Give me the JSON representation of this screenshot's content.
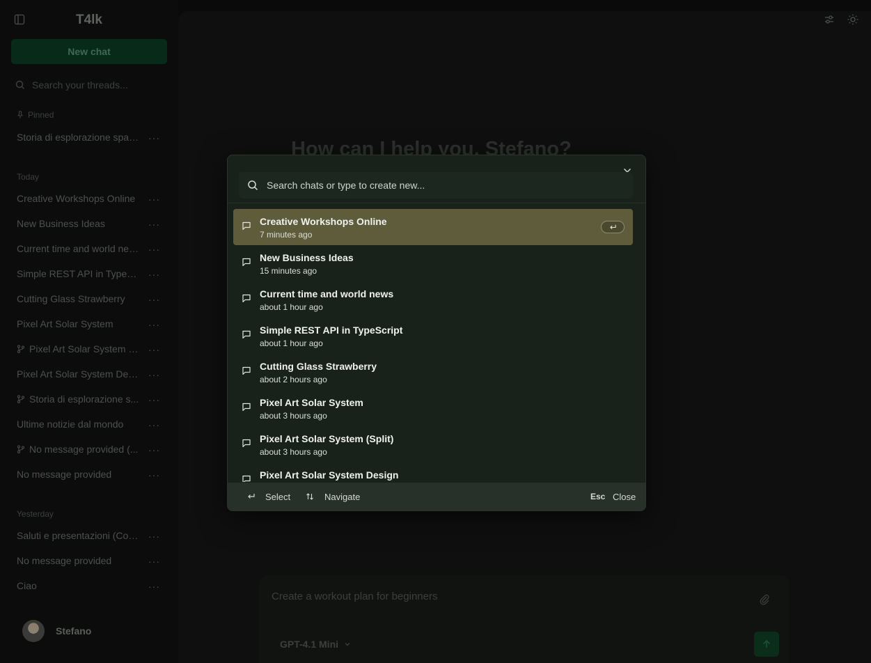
{
  "app": {
    "name": "T4lk"
  },
  "sidebar": {
    "new_chat_label": "New chat",
    "search_placeholder": "Search your threads...",
    "pinned_label": "Pinned",
    "pinned": [
      {
        "label": "Storia di esplorazione spazi..."
      }
    ],
    "today_label": "Today",
    "today": [
      {
        "label": "Creative Workshops Online",
        "branch": false
      },
      {
        "label": "New Business Ideas",
        "branch": false
      },
      {
        "label": "Current time and world news",
        "branch": false
      },
      {
        "label": "Simple REST API in TypeScr...",
        "branch": false
      },
      {
        "label": "Cutting Glass Strawberry",
        "branch": false
      },
      {
        "label": "Pixel Art Solar System",
        "branch": false
      },
      {
        "label": "Pixel Art Solar System (S...",
        "branch": true
      },
      {
        "label": "Pixel Art Solar System Design",
        "branch": false
      },
      {
        "label": "Storia di esplorazione s...",
        "branch": true
      },
      {
        "label": "Ultime notizie dal mondo",
        "branch": false
      },
      {
        "label": "No message provided (...",
        "branch": true
      },
      {
        "label": "No message provided",
        "branch": false
      }
    ],
    "yesterday_label": "Yesterday",
    "yesterday": [
      {
        "label": "Saluti e presentazioni (Copy)"
      },
      {
        "label": "No message provided"
      },
      {
        "label": "Ciao"
      }
    ],
    "more_glyph": "···",
    "user": {
      "name": "Stefano"
    }
  },
  "main": {
    "greeting": "How can I help you, Stefano?",
    "composer_placeholder": "Create a workout plan for beginners",
    "model": "GPT-4.1 Mini"
  },
  "modal": {
    "search_placeholder": "Search chats or type to create new...",
    "results": [
      {
        "title": "Creative Workshops Online",
        "time": "7 minutes ago",
        "active": true
      },
      {
        "title": "New Business Ideas",
        "time": "15 minutes ago",
        "active": false
      },
      {
        "title": "Current time and world news",
        "time": "about 1 hour ago",
        "active": false
      },
      {
        "title": "Simple REST API in TypeScript",
        "time": "about 1 hour ago",
        "active": false
      },
      {
        "title": "Cutting Glass Strawberry",
        "time": "about 2 hours ago",
        "active": false
      },
      {
        "title": "Pixel Art Solar System",
        "time": "about 3 hours ago",
        "active": false
      },
      {
        "title": "Pixel Art Solar System (Split)",
        "time": "about 3 hours ago",
        "active": false
      },
      {
        "title": "Pixel Art Solar System Design",
        "time": "",
        "active": false
      }
    ],
    "footer": {
      "select_label": "Select",
      "navigate_label": "Navigate",
      "esc_key": "Esc",
      "close_label": "Close"
    }
  },
  "colors": {
    "background": "#090a09",
    "modal_bg": "#18221b",
    "active_row": "#5e5c3b",
    "accent_green": "#082a18"
  }
}
